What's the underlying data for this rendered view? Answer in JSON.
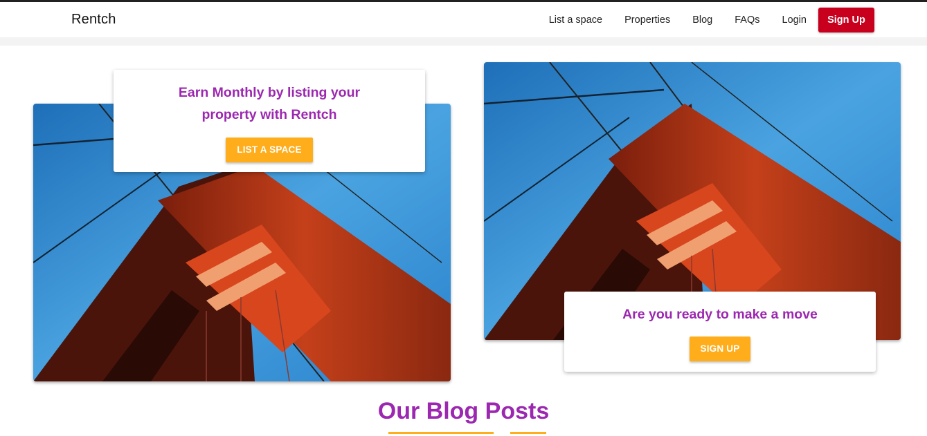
{
  "header": {
    "brand": "Rentch",
    "nav": [
      "List a space",
      "Properties",
      "Blog",
      "FAQs",
      "Login"
    ],
    "signup_label": "Sign Up"
  },
  "hero": {
    "left": {
      "title": "Earn Monthly by listing your property with Rentch",
      "button_label": "LIST A SPACE",
      "image": "golden-gate-bridge-tower"
    },
    "right": {
      "title": "Are you ready to make a move",
      "button_label": "SIGN UP",
      "image": "golden-gate-bridge-tower"
    }
  },
  "blog": {
    "heading": "Our Blog Posts"
  },
  "colors": {
    "brand_purple": "#9c27b0",
    "accent_orange": "#ffad1a",
    "signup_red": "#c8001e"
  }
}
